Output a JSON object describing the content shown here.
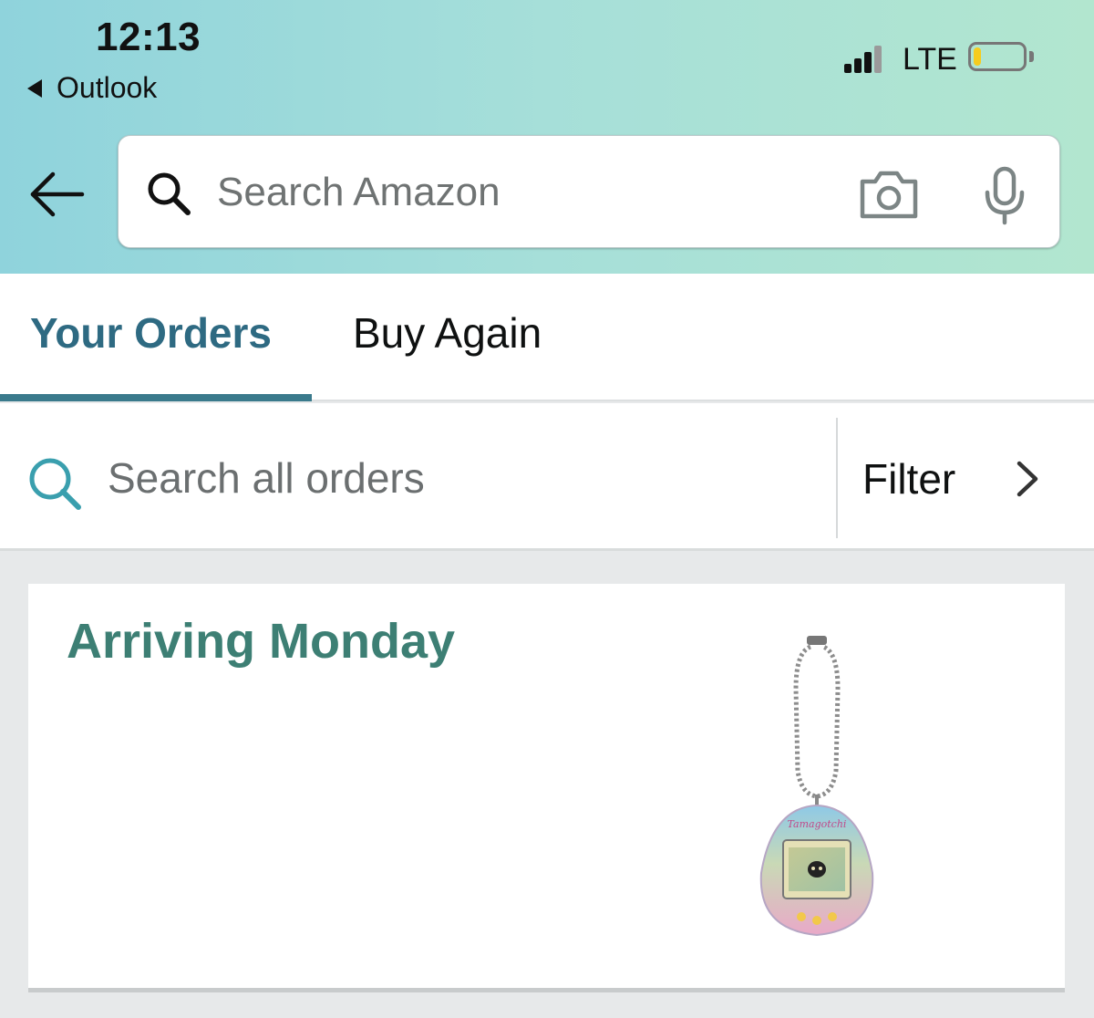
{
  "status_bar": {
    "time": "12:13",
    "back_app": "Outlook",
    "network": "LTE",
    "signal_bars": 3,
    "signal_bars_total": 4,
    "battery_level": 0.15,
    "battery_color": "#f6cc1e"
  },
  "header": {
    "gradient_colors": [
      "#8fd3dc",
      "#b2e6cf"
    ],
    "search_placeholder": "Search Amazon",
    "icons": [
      "back-arrow-icon",
      "search-icon",
      "camera-icon",
      "microphone-icon"
    ]
  },
  "tabs": [
    {
      "label": "Your Orders",
      "active": true
    },
    {
      "label": "Buy Again",
      "active": false
    }
  ],
  "accent_color": "#2e6a82",
  "orders_search": {
    "placeholder": "Search all orders",
    "filter_label": "Filter"
  },
  "order": {
    "status": "Arriving Monday",
    "status_color": "#3d7f74",
    "product_image": "tamagotchi-keychain",
    "product_logo_text": "Tamagotchi"
  }
}
